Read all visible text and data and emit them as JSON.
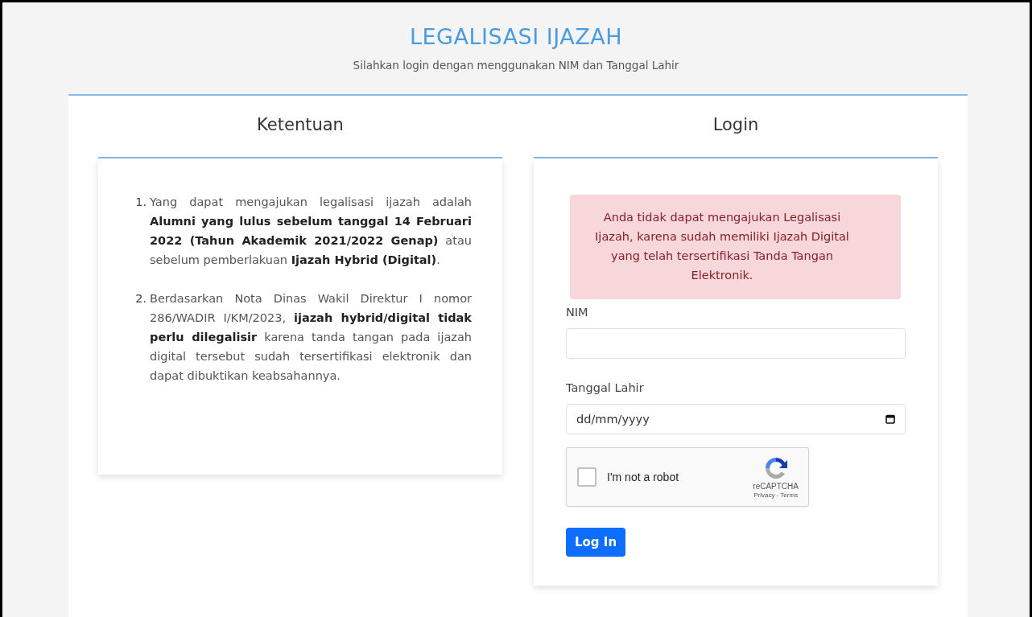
{
  "header": {
    "title": "LEGALISASI IJAZAH",
    "subtitle": "Silahkan login dengan menggunakan NIM dan Tanggal Lahir"
  },
  "terms": {
    "heading": "Ketentuan",
    "items": [
      {
        "number": "1.",
        "text": "Yang dapat mengajukan legalisasi ijazah adalah **Alumni yang lulus sebelum tanggal 14 Februari 2022 (Tahun Akademik 2021/2022 Genap)** atau sebelum pemberlakuan **Ijazah Hybrid (Digital)**."
      },
      {
        "number": "2.",
        "text": "Berdasarkan Nota Dinas Wakil Direktur I nomor 286/WADIR I/KM/2023, **ijazah hybrid/digital tidak perlu dilegalisir** karena tanda tangan pada ijazah digital tersebut sudah tersertifikasi elektronik dan dapat dibuktikan keabsahannya."
      }
    ]
  },
  "login": {
    "heading": "Login",
    "alert": "Anda tidak dapat mengajukan Legalisasi Ijazah, karena sudah memiliki Ijazah Digital yang telah tersertifikasi Tanda Tangan Elektronik.",
    "fields": [
      {
        "kind": "text",
        "label": "NIM"
      },
      {
        "kind": "date",
        "label": "Tanggal Lahir",
        "placeholder": "dd/mm/yyyy"
      }
    ],
    "captcha": {
      "label": "I'm not a robot",
      "brand": "reCAPTCHA",
      "links": "Privacy - Terms",
      "checked": false
    },
    "button": "Log In"
  }
}
